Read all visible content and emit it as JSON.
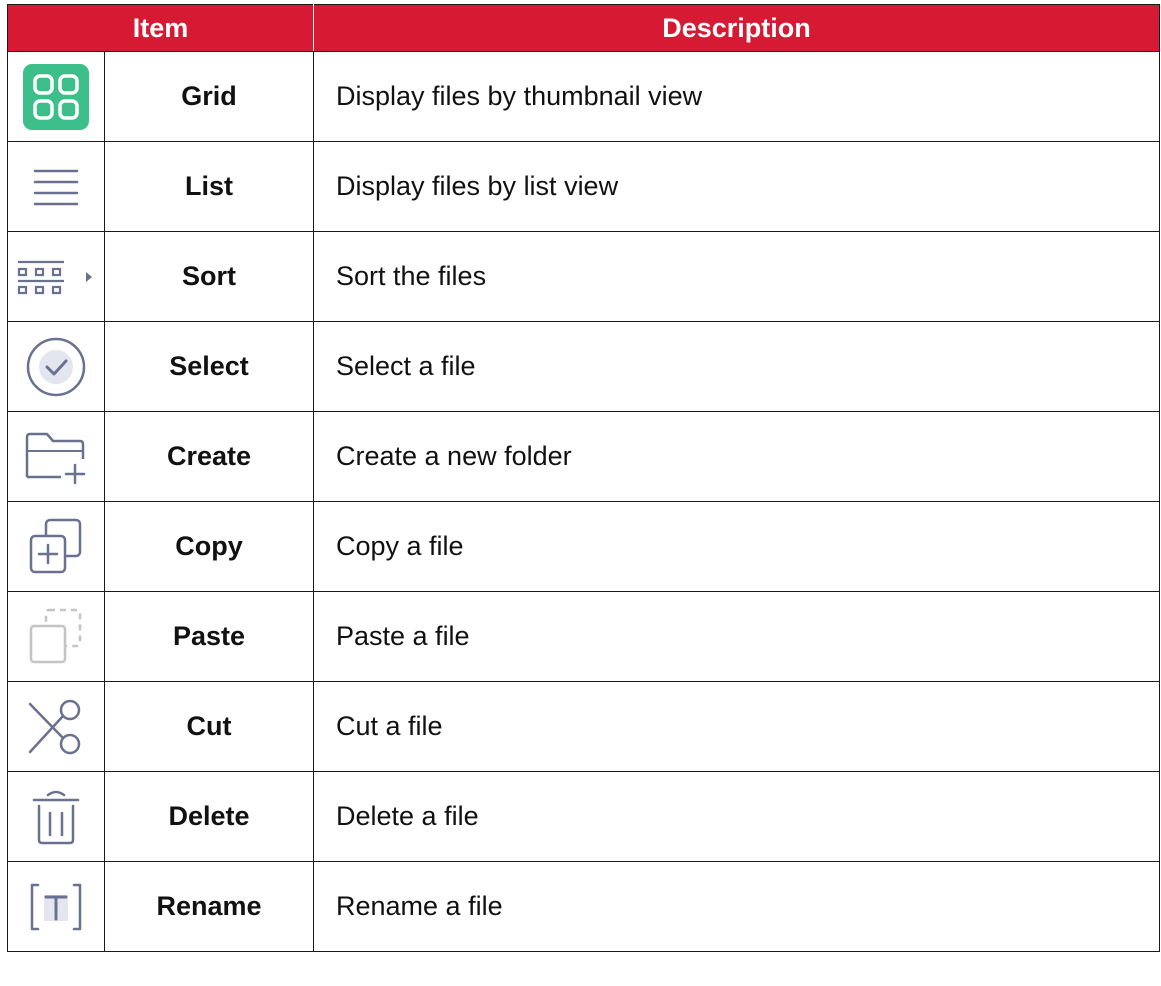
{
  "header": {
    "item": "Item",
    "description": "Description"
  },
  "rows": [
    {
      "icon": "grid-icon",
      "name": "Grid",
      "description": "Display files by thumbnail view"
    },
    {
      "icon": "list-icon",
      "name": "List",
      "description": "Display files by list view"
    },
    {
      "icon": "sort-icon",
      "name": "Sort",
      "description": "Sort the files"
    },
    {
      "icon": "select-icon",
      "name": "Select",
      "description": "Select a file"
    },
    {
      "icon": "create-folder-icon",
      "name": "Create",
      "description": "Create a new folder"
    },
    {
      "icon": "copy-icon",
      "name": "Copy",
      "description": "Copy a file"
    },
    {
      "icon": "paste-icon",
      "name": "Paste",
      "description": "Paste a file"
    },
    {
      "icon": "cut-icon",
      "name": "Cut",
      "description": "Cut a file"
    },
    {
      "icon": "delete-icon",
      "name": "Delete",
      "description": "Delete a file"
    },
    {
      "icon": "rename-icon",
      "name": "Rename",
      "description": "Rename a file"
    }
  ],
  "colors": {
    "header_bg": "#d71a33",
    "grid_icon_bg": "#3dbf8c",
    "icon_stroke": "#6a7090"
  }
}
